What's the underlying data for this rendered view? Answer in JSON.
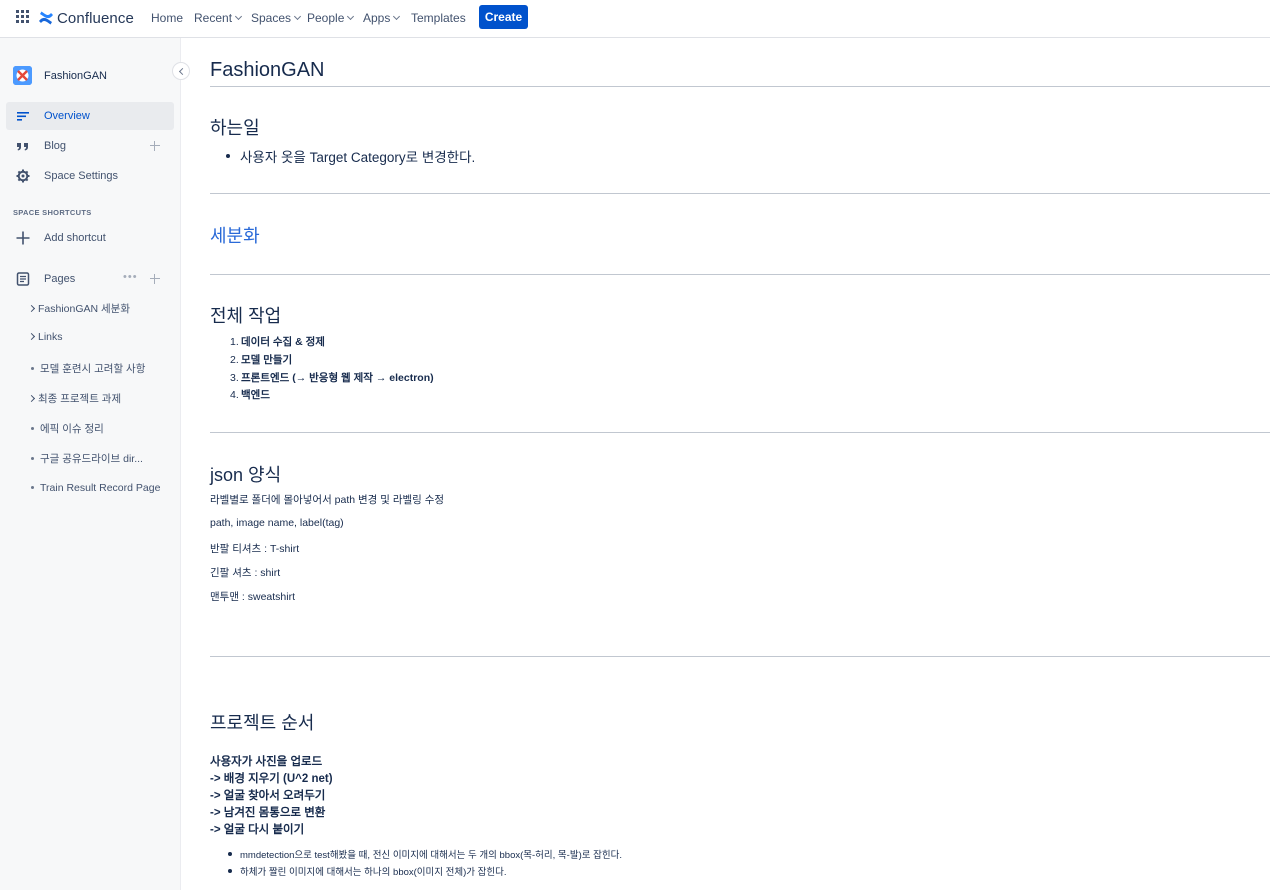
{
  "topnav": {
    "logo_text": "Confluence",
    "items": [
      {
        "label": "Home",
        "dropdown": false
      },
      {
        "label": "Recent",
        "dropdown": true
      },
      {
        "label": "Spaces",
        "dropdown": true
      },
      {
        "label": "People",
        "dropdown": true
      },
      {
        "label": "Apps",
        "dropdown": true
      },
      {
        "label": "Templates",
        "dropdown": false
      }
    ],
    "create_label": "Create"
  },
  "sidebar": {
    "space_name": "FashionGAN",
    "items": [
      {
        "label": "Overview",
        "icon": "overview-icon",
        "active": true
      },
      {
        "label": "Blog",
        "icon": "quote-icon",
        "active": false
      },
      {
        "label": "Space Settings",
        "icon": "gear-icon",
        "active": false
      }
    ],
    "shortcuts_heading": "SPACE SHORTCUTS",
    "add_shortcut_label": "Add shortcut",
    "pages_label": "Pages",
    "pages": [
      {
        "label": "FashionGAN 세분화",
        "expandable": true
      },
      {
        "label": "Links",
        "expandable": true
      },
      {
        "label": "모델 훈련시 고려할 사항",
        "expandable": false
      },
      {
        "label": "최종 프로젝트 과제",
        "expandable": true
      },
      {
        "label": "에픽 이슈 정리",
        "expandable": false
      },
      {
        "label": "구글 공유드라이브 dir...",
        "expandable": false
      },
      {
        "label": "Train Result Record Page",
        "expandable": false
      }
    ]
  },
  "content": {
    "title": "FashionGAN",
    "section1": {
      "heading": "하는일",
      "bullet": "사용자 옷을 Target Category로 변경한다."
    },
    "section2": {
      "heading": "세분화"
    },
    "section3": {
      "heading": "전체 작업",
      "items": [
        "데이터 수집 & 정제",
        "모델 만들기",
        "프론트엔드 (→ 반응형 웹 제작 → electron)",
        "백엔드"
      ]
    },
    "section4": {
      "heading": "json 양식",
      "lines": [
        "라벨별로 폴더에 몰아넣어서 path 변경 및 라벨링 수정",
        "path, image name, label(tag)",
        "반팔 티셔츠 : T-shirt",
        "긴팔 셔츠 : shirt",
        "맨투맨 : sweatshirt"
      ]
    },
    "section5": {
      "heading": "프로젝트 순서",
      "steps": [
        "사용자가 사진을 업로드",
        "-> 배경 지우기 (U^2 net)",
        "-> 얼굴 찾아서 오려두기",
        "-> 남겨진 몸통으로 변환",
        "-> 얼굴 다시 붙이기"
      ],
      "notes": [
        "mmdetection으로 test해봤을 때, 전신 이미지에 대해서는 두 개의 bbox(목-허리, 목-발)로 잡힌다.",
        "하체가 짤린 이미지에 대해서는 하나의 bbox(이미지 전체)가 잡힌다."
      ]
    }
  },
  "colors": {
    "accent": "#0052cc",
    "link": "#2a6ad8",
    "sidebar_bg": "#f7f8f9"
  }
}
